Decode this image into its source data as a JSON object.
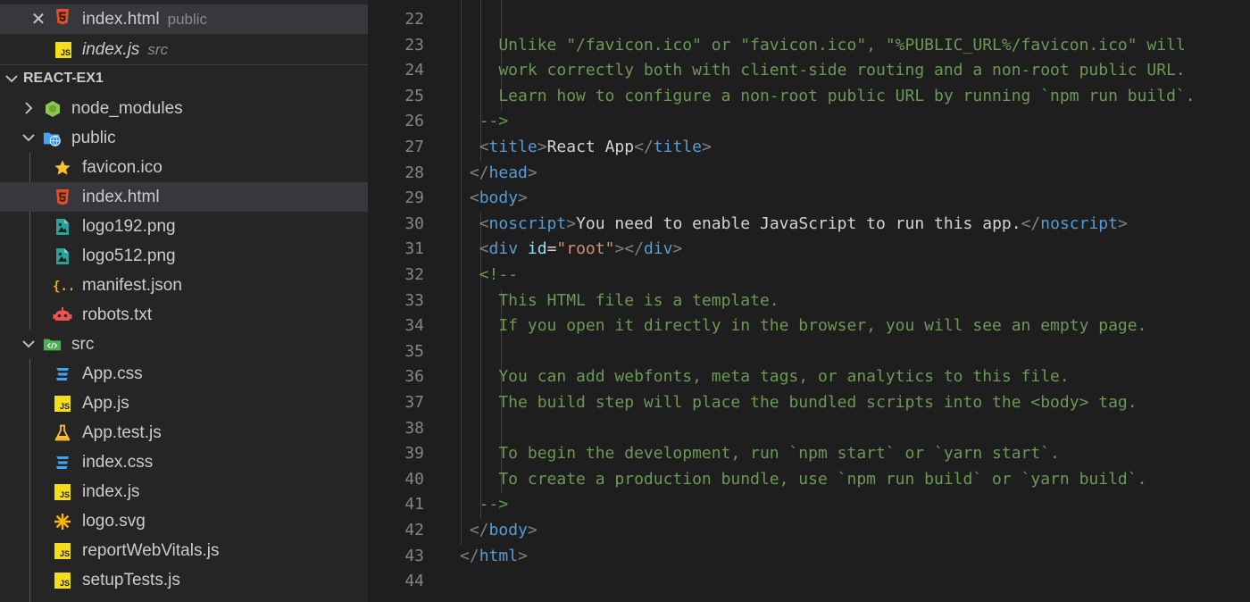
{
  "open_editors": [
    {
      "name": "index.html",
      "description": "public",
      "icon": "html5-icon",
      "active": true,
      "italic": false
    },
    {
      "name": "index.js",
      "description": "src",
      "icon": "javascript-icon",
      "active": false,
      "italic": true
    }
  ],
  "explorer": {
    "section_title": "REACT-EX1",
    "items": [
      {
        "label": "node_modules",
        "type": "folder",
        "collapsed": true,
        "icon": "node-folder-icon"
      },
      {
        "label": "public",
        "type": "folder",
        "collapsed": false,
        "icon": "public-folder-icon"
      },
      {
        "label": "favicon.ico",
        "type": "file",
        "icon": "star-icon"
      },
      {
        "label": "index.html",
        "type": "file",
        "icon": "html5-icon",
        "selected": true
      },
      {
        "label": "logo192.png",
        "type": "file",
        "icon": "image-icon"
      },
      {
        "label": "logo512.png",
        "type": "file",
        "icon": "image-icon"
      },
      {
        "label": "manifest.json",
        "type": "file",
        "icon": "json-braces-icon"
      },
      {
        "label": "robots.txt",
        "type": "file",
        "icon": "robot-icon"
      },
      {
        "label": "src",
        "type": "folder",
        "collapsed": false,
        "icon": "src-folder-icon"
      },
      {
        "label": "App.css",
        "type": "file",
        "icon": "css3-icon"
      },
      {
        "label": "App.js",
        "type": "file",
        "icon": "javascript-icon"
      },
      {
        "label": "App.test.js",
        "type": "file",
        "icon": "test-flask-icon"
      },
      {
        "label": "index.css",
        "type": "file",
        "icon": "css3-icon"
      },
      {
        "label": "index.js",
        "type": "file",
        "icon": "javascript-icon"
      },
      {
        "label": "logo.svg",
        "type": "file",
        "icon": "svg-asterisk-icon"
      },
      {
        "label": "reportWebVitals.js",
        "type": "file",
        "icon": "javascript-icon"
      },
      {
        "label": "setupTests.js",
        "type": "file",
        "icon": "javascript-icon"
      }
    ]
  },
  "editor": {
    "lines": [
      {
        "num": "22",
        "tokens": []
      },
      {
        "num": "23",
        "tokens": [
          {
            "t": "cm",
            "v": "    Unlike \"/favicon.ico\" or \"favicon.ico\", \"%PUBLIC_URL%/favicon.ico\" will"
          }
        ]
      },
      {
        "num": "24",
        "tokens": [
          {
            "t": "cm",
            "v": "    work correctly both with client-side routing and a non-root public URL."
          }
        ]
      },
      {
        "num": "25",
        "tokens": [
          {
            "t": "cm",
            "v": "    Learn how to configure a non-root public URL by running `npm run build`."
          }
        ]
      },
      {
        "num": "26",
        "tokens": [
          {
            "t": "cm",
            "v": "  -->"
          }
        ]
      },
      {
        "num": "27",
        "tokens": [
          {
            "t": "text",
            "v": "  "
          },
          {
            "t": "punct",
            "v": "<"
          },
          {
            "t": "tag",
            "v": "title"
          },
          {
            "t": "punct",
            "v": ">"
          },
          {
            "t": "text",
            "v": "React App"
          },
          {
            "t": "punct",
            "v": "</"
          },
          {
            "t": "tag",
            "v": "title"
          },
          {
            "t": "punct",
            "v": ">"
          }
        ]
      },
      {
        "num": "28",
        "tokens": [
          {
            "t": "text",
            "v": " "
          },
          {
            "t": "punct",
            "v": "</"
          },
          {
            "t": "tag",
            "v": "head"
          },
          {
            "t": "punct",
            "v": ">"
          }
        ]
      },
      {
        "num": "29",
        "tokens": [
          {
            "t": "text",
            "v": " "
          },
          {
            "t": "punct",
            "v": "<"
          },
          {
            "t": "tag",
            "v": "body"
          },
          {
            "t": "punct",
            "v": ">"
          }
        ]
      },
      {
        "num": "30",
        "tokens": [
          {
            "t": "text",
            "v": "  "
          },
          {
            "t": "punct",
            "v": "<"
          },
          {
            "t": "tag",
            "v": "noscript"
          },
          {
            "t": "punct",
            "v": ">"
          },
          {
            "t": "text",
            "v": "You need to enable JavaScript to run this app."
          },
          {
            "t": "punct",
            "v": "</"
          },
          {
            "t": "tag",
            "v": "noscript"
          },
          {
            "t": "punct",
            "v": ">"
          }
        ]
      },
      {
        "num": "31",
        "tokens": [
          {
            "t": "text",
            "v": "  "
          },
          {
            "t": "punct",
            "v": "<"
          },
          {
            "t": "tag",
            "v": "div"
          },
          {
            "t": "text",
            "v": " "
          },
          {
            "t": "attr",
            "v": "id"
          },
          {
            "t": "text",
            "v": "="
          },
          {
            "t": "str",
            "v": "\"root\""
          },
          {
            "t": "punct",
            "v": "></"
          },
          {
            "t": "tag",
            "v": "div"
          },
          {
            "t": "punct",
            "v": ">"
          }
        ]
      },
      {
        "num": "32",
        "tokens": [
          {
            "t": "cm",
            "v": "  <!--"
          }
        ]
      },
      {
        "num": "33",
        "tokens": [
          {
            "t": "cm",
            "v": "    This HTML file is a template."
          }
        ]
      },
      {
        "num": "34",
        "tokens": [
          {
            "t": "cm",
            "v": "    If you open it directly in the browser, you will see an empty page."
          }
        ]
      },
      {
        "num": "35",
        "tokens": []
      },
      {
        "num": "36",
        "tokens": [
          {
            "t": "cm",
            "v": "    You can add webfonts, meta tags, or analytics to this file."
          }
        ]
      },
      {
        "num": "37",
        "tokens": [
          {
            "t": "cm",
            "v": "    The build step will place the bundled scripts into the <body> tag."
          }
        ]
      },
      {
        "num": "38",
        "tokens": []
      },
      {
        "num": "39",
        "tokens": [
          {
            "t": "cm",
            "v": "    To begin the development, run `npm start` or `yarn start`."
          }
        ]
      },
      {
        "num": "40",
        "tokens": [
          {
            "t": "cm",
            "v": "    To create a production bundle, use `npm run build` or `yarn build`."
          }
        ]
      },
      {
        "num": "41",
        "tokens": [
          {
            "t": "cm",
            "v": "  -->"
          }
        ]
      },
      {
        "num": "42",
        "tokens": [
          {
            "t": "text",
            "v": " "
          },
          {
            "t": "punct",
            "v": "</"
          },
          {
            "t": "tag",
            "v": "body"
          },
          {
            "t": "punct",
            "v": ">"
          }
        ]
      },
      {
        "num": "43",
        "tokens": [
          {
            "t": "punct",
            "v": "</"
          },
          {
            "t": "tag",
            "v": "html"
          },
          {
            "t": "punct",
            "v": ">"
          }
        ]
      },
      {
        "num": "44",
        "tokens": []
      }
    ]
  },
  "colors": {
    "sidebar_bg": "#252526",
    "editor_bg": "#1e1e1e",
    "selection_bg": "#37373d",
    "tag": "#569cd6",
    "attribute": "#9cdcfe",
    "string": "#ce9178",
    "comment": "#6a9955",
    "punctuation": "#808080",
    "line_number": "#858585"
  }
}
